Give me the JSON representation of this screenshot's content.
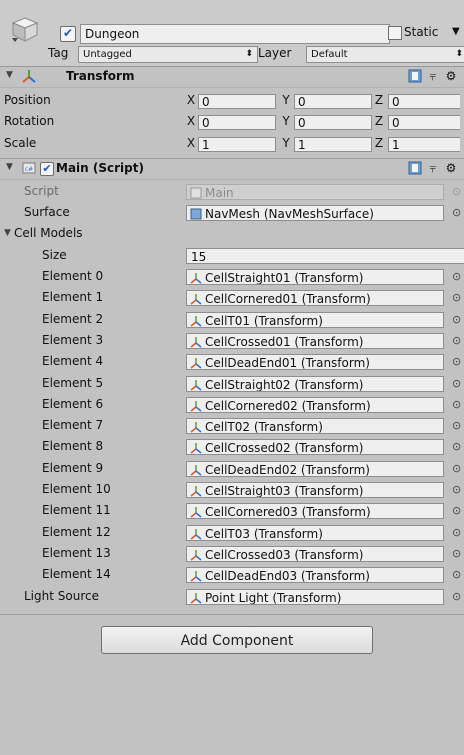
{
  "gameobject": {
    "name": "Dungeon",
    "active": true,
    "static_label": "Static",
    "static_checked": false,
    "tag_label": "Tag",
    "tag_value": "Untagged",
    "layer_label": "Layer",
    "layer_value": "Default"
  },
  "transform": {
    "title": "Transform",
    "rows": [
      {
        "label": "Position",
        "x": "0",
        "y": "0",
        "z": "0"
      },
      {
        "label": "Rotation",
        "x": "0",
        "y": "0",
        "z": "0"
      },
      {
        "label": "Scale",
        "x": "1",
        "y": "1",
        "z": "1"
      }
    ],
    "axis": {
      "x": "X",
      "y": "Y",
      "z": "Z"
    }
  },
  "script_component": {
    "title": "Main (Script)",
    "enabled": true,
    "script_label": "Script",
    "script_value": "Main",
    "surface_label": "Surface",
    "surface_value": "NavMesh (NavMeshSurface)",
    "cell_models_label": "Cell Models",
    "size_label": "Size",
    "size_value": "15",
    "elements": [
      {
        "label": "Element 0",
        "value": "CellStraight01 (Transform)"
      },
      {
        "label": "Element 1",
        "value": "CellCornered01 (Transform)"
      },
      {
        "label": "Element 2",
        "value": "CellT01 (Transform)"
      },
      {
        "label": "Element 3",
        "value": "CellCrossed01 (Transform)"
      },
      {
        "label": "Element 4",
        "value": "CellDeadEnd01 (Transform)"
      },
      {
        "label": "Element 5",
        "value": "CellStraight02 (Transform)"
      },
      {
        "label": "Element 6",
        "value": "CellCornered02 (Transform)"
      },
      {
        "label": "Element 7",
        "value": "CellT02 (Transform)"
      },
      {
        "label": "Element 8",
        "value": "CellCrossed02 (Transform)"
      },
      {
        "label": "Element 9",
        "value": "CellDeadEnd02 (Transform)"
      },
      {
        "label": "Element 10",
        "value": "CellStraight03 (Transform)"
      },
      {
        "label": "Element 11",
        "value": "CellCornered03 (Transform)"
      },
      {
        "label": "Element 12",
        "value": "CellT03 (Transform)"
      },
      {
        "label": "Element 13",
        "value": "CellCrossed03 (Transform)"
      },
      {
        "label": "Element 14",
        "value": "CellDeadEnd03 (Transform)"
      }
    ],
    "light_source_label": "Light Source",
    "light_source_value": "Point Light (Transform)"
  },
  "add_component_label": "Add Component",
  "colors": {
    "background": "#c2c2c2",
    "field": "#efefef",
    "checkbox_tick": "#1a5db0",
    "transform_icon": "#e2542b"
  }
}
